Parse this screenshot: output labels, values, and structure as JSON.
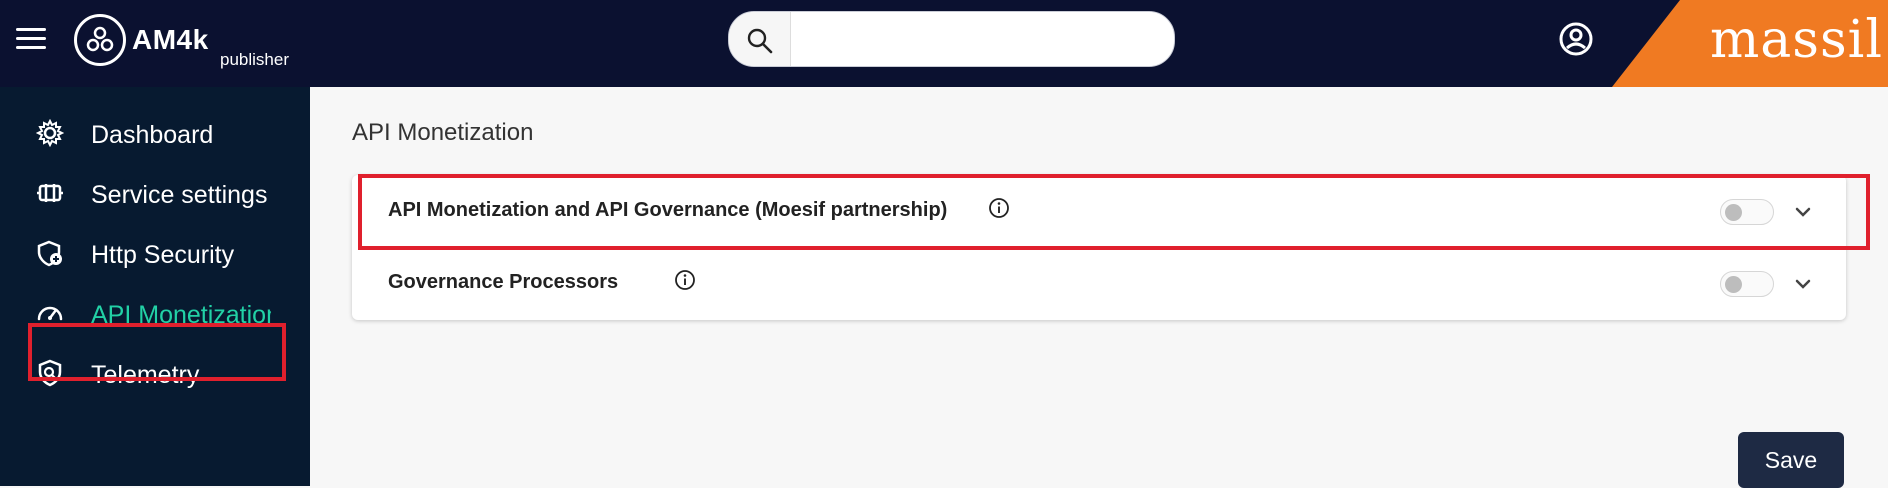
{
  "header": {
    "brand_name": "AM4k",
    "brand_sub": "publisher",
    "search": {
      "value": "",
      "placeholder": ""
    },
    "partner_logo_text": "massil"
  },
  "sidebar": {
    "items": [
      {
        "label": "Dashboard",
        "icon": "gear-icon"
      },
      {
        "label": "Service settings",
        "icon": "settings-panel-icon"
      },
      {
        "label": "Http Security",
        "icon": "shield-add-icon"
      },
      {
        "label": "API Monetization",
        "icon": "speedometer-icon",
        "active": true
      },
      {
        "label": "Telemetry",
        "icon": "shield-search-icon"
      }
    ],
    "active_color": "#22d1a6"
  },
  "main": {
    "title": "API Monetization",
    "rows": [
      {
        "label": "API Monetization and API Governance (Moesif partnership)",
        "enabled": false
      },
      {
        "label": "Governance Processors",
        "enabled": false
      }
    ],
    "save_label": "Save"
  },
  "colors": {
    "topbar": "#0b1130",
    "sidebar": "#071a30",
    "accent_orange": "#f07a22",
    "highlight_red": "#e0202d",
    "save_button": "#1e2a44"
  }
}
